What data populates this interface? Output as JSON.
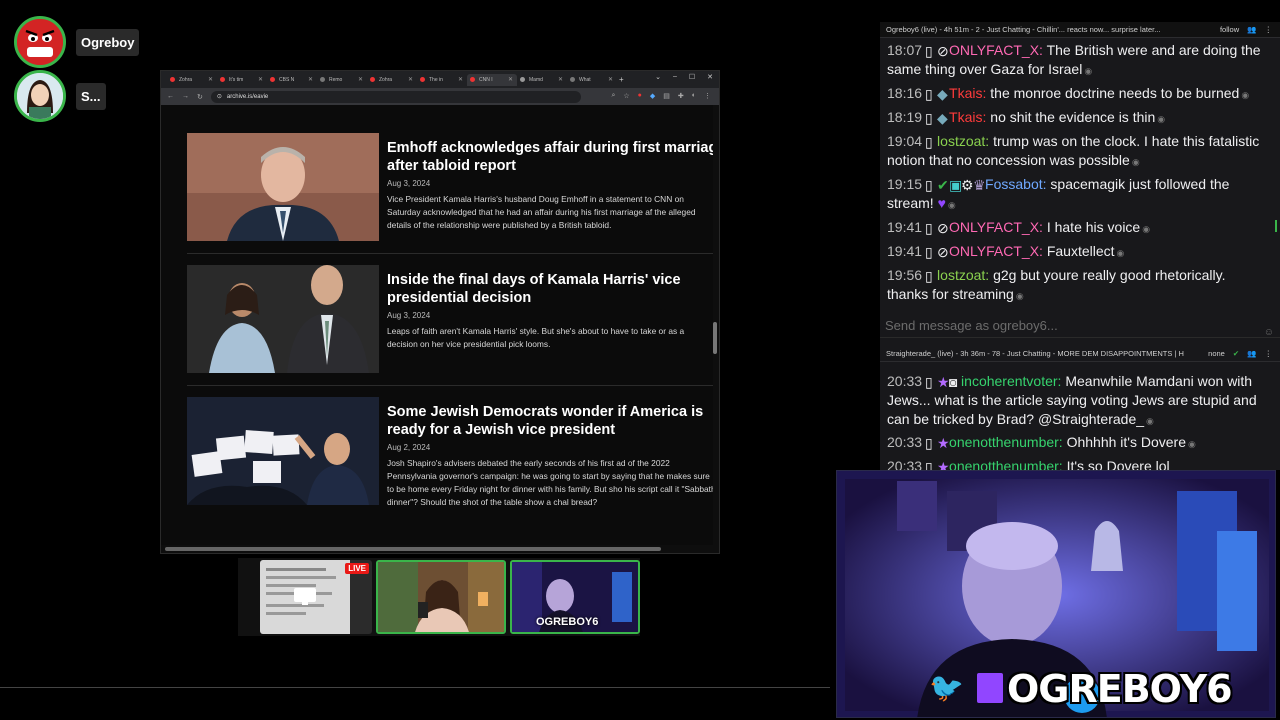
{
  "participants": [
    {
      "name": "Ogreboy",
      "color": "#d32424"
    },
    {
      "name": "S...",
      "color": "#f2d8c4"
    }
  ],
  "browser": {
    "tabs": [
      "Zohra",
      "It's tim",
      "CBS N",
      "Remo",
      "Zohra",
      "The in",
      "CNN I",
      "Mamd",
      "What"
    ],
    "url": "archive.is/eavie",
    "articles": [
      {
        "title": "Emhoff acknowledges affair during first marriage after tabloid report",
        "date": "Aug 3, 2024",
        "desc": "Vice President Kamala Harris's husband Doug Emhoff in a statement to CNN on Saturday acknowledged that he had an affair during his first marriage af the alleged details of the relationship were published by a British tabloid."
      },
      {
        "title": "Inside the final days of Kamala Harris' vice presidential decision",
        "date": "Aug 3, 2024",
        "desc": "Leaps of faith aren't Kamala Harris' style. But she's about to have to take or as a decision on her vice presidential pick looms."
      },
      {
        "title": "Some Jewish Democrats wonder if America is ready for a Jewish vice president",
        "date": "Aug 2, 2024",
        "desc": "Josh Shapiro's advisers debated the early seconds of his first ad of the 2022 Pennsylvania governor's campaign: he was going to start by saying that he makes sure to be home every Friday night for dinner with his family. But sho his script call it \"Sabbath dinner\"? Should the shot of the table show a chal bread?"
      }
    ]
  },
  "streams": {
    "live_label": "LIVE",
    "channel_caption": "OGREBOY6"
  },
  "chat": {
    "header1": {
      "text": "Ogreboy6 (live) - 4h 51m - 2 - Just Chatting - Chillin'... reacts now... surprise later...",
      "action": "follow"
    },
    "messages1": [
      {
        "time": "18:07",
        "user": "ONLYFACT_X:",
        "color": "#ff69b4",
        "text": "The British were and are doing the same thing over Gaza for Israel"
      },
      {
        "time": "18:16",
        "user": "Tkais:",
        "color": "#ff3b3b",
        "text": "the monroe doctrine needs to be burned"
      },
      {
        "time": "18:19",
        "user": "Tkais:",
        "color": "#ff3b3b",
        "text": "no shit the evidence is thin"
      },
      {
        "time": "19:04",
        "user": "lostzoat:",
        "color": "#8ad14f",
        "text": "trump was on the clock. I hate this fatalistic notion that no concession was possible"
      },
      {
        "time": "19:15",
        "user": "Fossabot:",
        "color": "#6fa8ff",
        "text": "spacemagik just followed the stream!"
      },
      {
        "time": "19:41",
        "user": "ONLYFACT_X:",
        "color": "#ff69b4",
        "text": "I hate his voice"
      },
      {
        "time": "19:41",
        "user": "ONLYFACT_X:",
        "color": "#ff69b4",
        "text": "Fauxtellect"
      },
      {
        "time": "19:56",
        "user": "lostzoat:",
        "color": "#8ad14f",
        "text": "g2g but youre really good rhetorically. thanks for streaming"
      }
    ],
    "send_placeholder": "Send message as ogreboy6...",
    "header2": {
      "text": "Straighterade_ (live) - 3h 36m - 78 - Just Chatting - MORE DEM DISAPPOINTMENTS | H",
      "action": "none"
    },
    "messages2": [
      {
        "time": "20:33",
        "user": "incoherentvoter:",
        "color": "#36d36e",
        "text": "Meanwhile Mamdani won with Jews... what is the article saying voting Jews are stupid and can be tricked by Brad? @Straighterade_"
      },
      {
        "time": "20:33",
        "user": "onenotthenumber:",
        "color": "#36d36e",
        "text": "Ohhhhh it's Dovere"
      },
      {
        "time": "20:33",
        "user": "onenotthenumber:",
        "color": "#36d36e",
        "text": "It's so Dovere lol"
      }
    ]
  },
  "webcam": {
    "name": "OGREBOY6"
  }
}
